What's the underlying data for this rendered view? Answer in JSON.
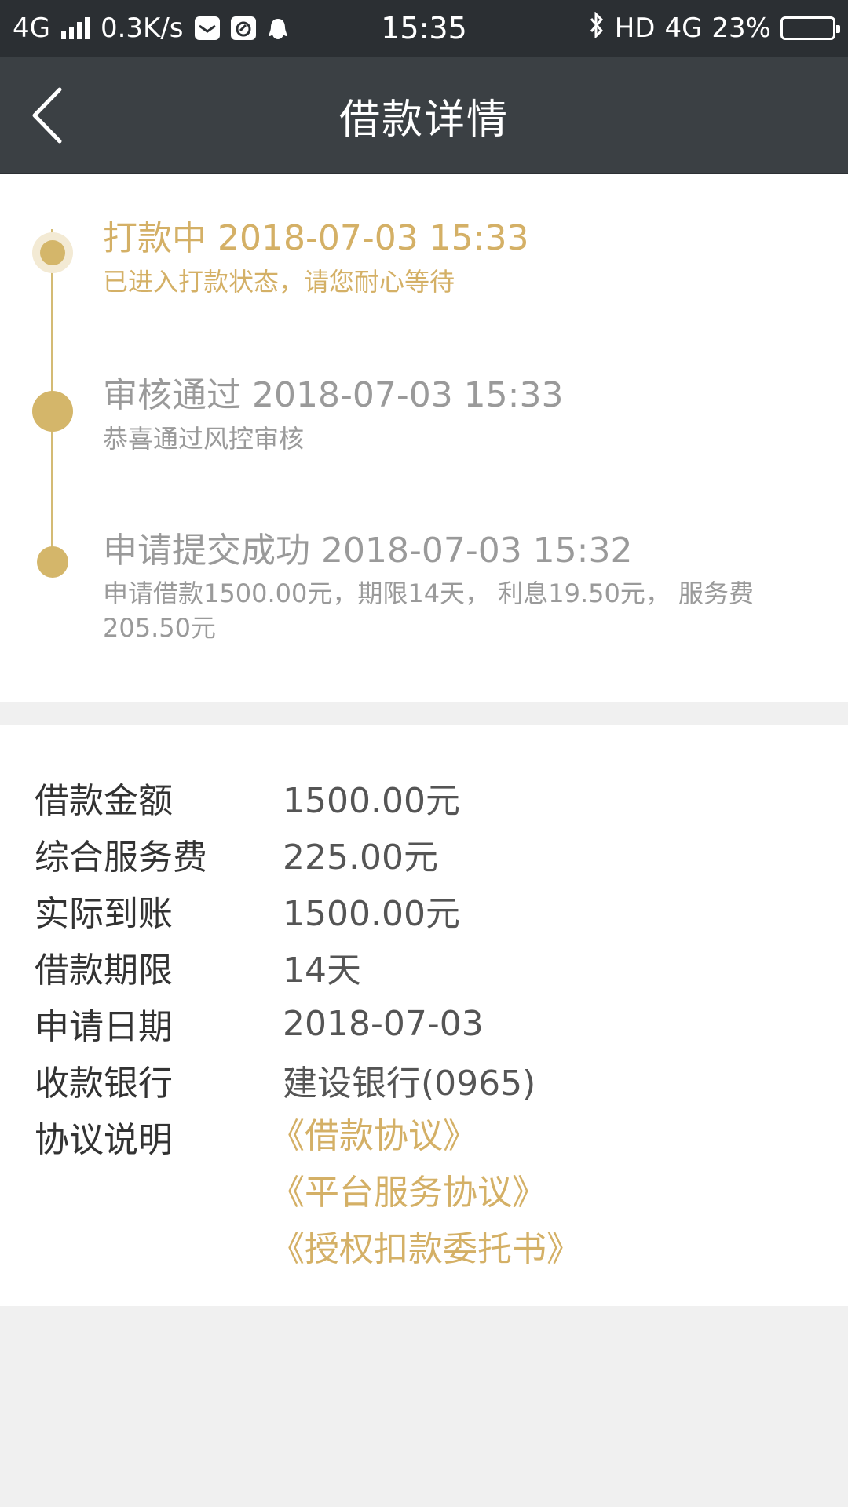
{
  "status_bar": {
    "network": "4G",
    "speed": "0.3K/s",
    "time": "15:35",
    "hd": "HD",
    "network_right": "4G",
    "battery": "23%"
  },
  "header": {
    "title": "借款详情",
    "back_icon": "chevron-left-icon"
  },
  "timeline": [
    {
      "title": "打款中 2018-07-03 15:33",
      "desc": "已进入打款状态，请您耐心等待",
      "active": true
    },
    {
      "title": "审核通过 2018-07-03 15:33",
      "desc": "恭喜通过风控审核",
      "active": false
    },
    {
      "title": "申请提交成功 2018-07-03 15:32",
      "desc": "申请借款1500.00元，期限14天， 利息19.50元， 服务费205.50元",
      "active": false
    }
  ],
  "details": {
    "rows": [
      {
        "label": "借款金额",
        "value": "1500.00元"
      },
      {
        "label": "综合服务费",
        "value": "225.00元"
      },
      {
        "label": "实际到账",
        "value": "1500.00元"
      },
      {
        "label": "借款期限",
        "value": "14天"
      },
      {
        "label": "申请日期",
        "value": "2018-07-03"
      },
      {
        "label": "收款银行",
        "value": "建设银行(0965)"
      }
    ],
    "agreement_label": "协议说明",
    "agreements": [
      "《借款协议》",
      "《平台服务协议》",
      "《授权扣款委托书》"
    ]
  },
  "colors": {
    "accent": "#d4b066",
    "header_bg": "#3b4044",
    "status_bg": "#2b2f33",
    "page_bg": "#f0f0f0"
  }
}
